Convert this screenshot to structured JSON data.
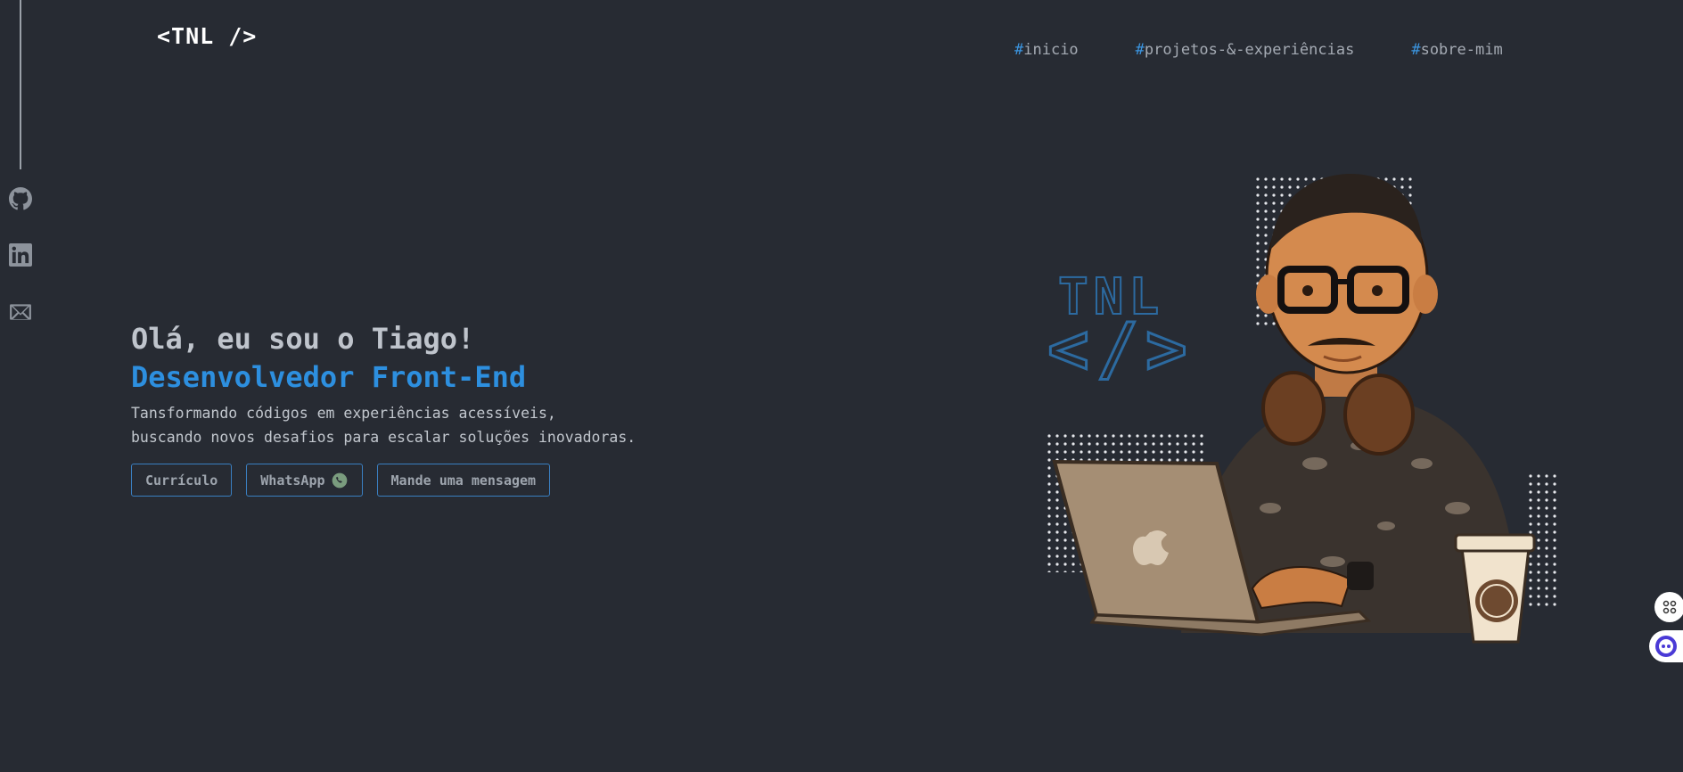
{
  "header": {
    "logo": "<TNL />",
    "nav": [
      {
        "hash": "#",
        "label": "inicio"
      },
      {
        "hash": "#",
        "label": "projetos-&-experiências"
      },
      {
        "hash": "#",
        "label": "sobre-mim"
      }
    ]
  },
  "social": [
    {
      "icon": "github-icon"
    },
    {
      "icon": "linkedin-icon"
    },
    {
      "icon": "mail-icon"
    }
  ],
  "hero": {
    "greeting": "Olá, eu sou o Tiago!",
    "role": "Desenvolvedor Front-End",
    "tagline_line1": "Tansformando códigos em experiências acessíveis,",
    "tagline_line2": "buscando novos desafios para escalar soluções inovadoras.",
    "buttons": {
      "resume": "Currículo",
      "whatsapp": "WhatsApp",
      "message": "Mande uma mensagem"
    }
  },
  "illustration": {
    "badge_top": "TNL",
    "badge_bottom": "</>"
  },
  "colors": {
    "background": "#272b33",
    "accent": "#2d8fdf"
  }
}
